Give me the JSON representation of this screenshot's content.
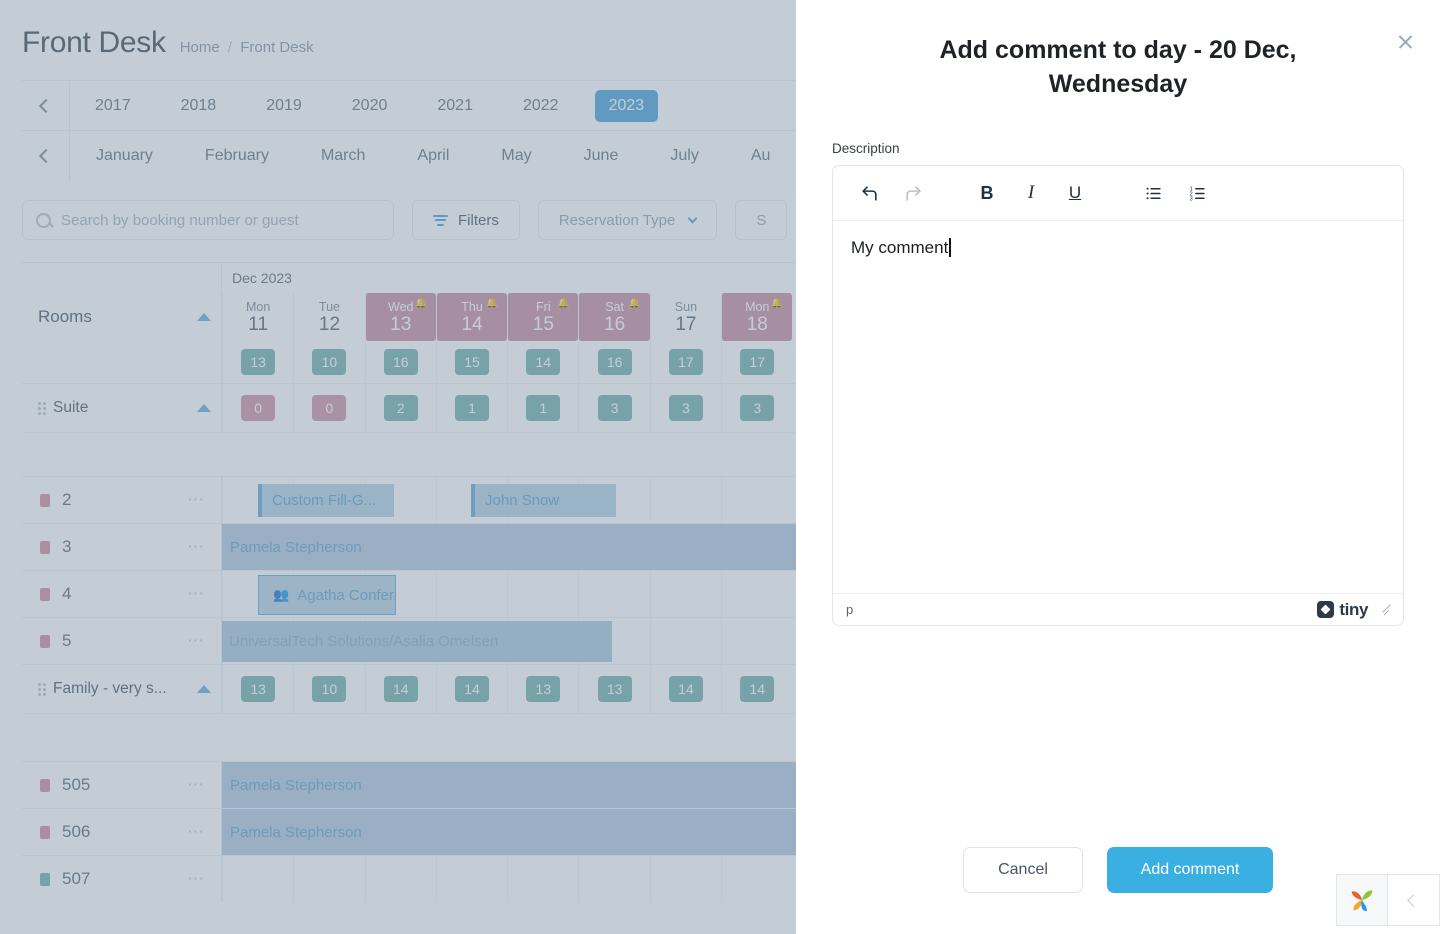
{
  "app": {
    "title": "Front Desk",
    "breadcrumb": {
      "home": "Home",
      "separator": "/",
      "current": "Front Desk"
    },
    "years": [
      "2017",
      "2018",
      "2019",
      "2020",
      "2021",
      "2022",
      "2023"
    ],
    "active_year": "2023",
    "months": [
      "January",
      "February",
      "March",
      "April",
      "May",
      "June",
      "July",
      "Au"
    ],
    "search": {
      "placeholder": "Search by booking number or guest",
      "value": ""
    },
    "filters_label": "Filters",
    "reservation_type_label": "Reservation Type",
    "third_filter_label": "S",
    "accent_color": "#4aa3d8",
    "highlight_day_color": "#c98fa0",
    "count_pill_color": "#74b3ab",
    "count_pill_red_color": "#cf93a2"
  },
  "grid": {
    "month_label": "Dec 2023",
    "rooms_label": "Rooms",
    "days": [
      {
        "dow": "Mon",
        "num": "11",
        "highlight": false,
        "bell": false
      },
      {
        "dow": "Tue",
        "num": "12",
        "highlight": false,
        "bell": false
      },
      {
        "dow": "Wed",
        "num": "13",
        "highlight": true,
        "bell": true
      },
      {
        "dow": "Thu",
        "num": "14",
        "highlight": true,
        "bell": true
      },
      {
        "dow": "Fri",
        "num": "15",
        "highlight": true,
        "bell": true
      },
      {
        "dow": "Sat",
        "num": "16",
        "highlight": true,
        "bell": true
      },
      {
        "dow": "Sun",
        "num": "17",
        "highlight": false,
        "bell": false
      },
      {
        "dow": "Mon",
        "num": "18",
        "highlight": true,
        "bell": true
      }
    ],
    "rooms_counts": [
      "13",
      "10",
      "16",
      "15",
      "14",
      "16",
      "17",
      "17"
    ],
    "groups": [
      {
        "name": "Suite",
        "counts": [
          "0",
          "0",
          "2",
          "1",
          "1",
          "3",
          "3",
          "3"
        ],
        "counts_red": [
          true,
          true,
          false,
          false,
          false,
          false,
          false,
          false
        ],
        "rooms": [
          {
            "num": "2",
            "status": "pink"
          },
          {
            "num": "3",
            "status": "pink"
          },
          {
            "num": "4",
            "status": "pink"
          },
          {
            "num": "5",
            "status": "pink"
          }
        ]
      },
      {
        "name": "Family - very s...",
        "counts": [
          "13",
          "10",
          "14",
          "14",
          "13",
          "13",
          "14",
          "14"
        ],
        "counts_red": [
          false,
          false,
          false,
          false,
          false,
          false,
          false,
          false
        ],
        "rooms": [
          {
            "num": "505",
            "status": "pink"
          },
          {
            "num": "506",
            "status": "pink"
          },
          {
            "num": "507",
            "status": "green"
          }
        ]
      }
    ],
    "reservations": {
      "custom_fill": "Custom Fill-G...",
      "john_snow": "John Snow",
      "pamela_1": "Pamela Stepherson",
      "agatha": "Agatha Confer...",
      "universal": "UniversalTech Solutions/Asalia Omelsen",
      "pamela_505": "Pamela Stepherson",
      "pamela_506": "Pamela Stepherson"
    }
  },
  "modal": {
    "title": "Add comment to day - 20 Dec, Wednesday",
    "description_label": "Description",
    "editor": {
      "content": "My comment",
      "status_path": "p",
      "brand": "tiny",
      "toolbar": [
        {
          "name": "undo",
          "glyph": "↶",
          "disabled": false
        },
        {
          "name": "redo",
          "glyph": "↷",
          "disabled": true
        },
        {
          "name": "bold",
          "glyph": "B",
          "disabled": false
        },
        {
          "name": "italic",
          "glyph": "I",
          "disabled": false
        },
        {
          "name": "underline",
          "glyph": "U",
          "disabled": false
        },
        {
          "name": "bullet-list",
          "glyph": "☰",
          "disabled": false
        },
        {
          "name": "numbered-list",
          "glyph": "☷",
          "disabled": false
        }
      ]
    },
    "cancel_label": "Cancel",
    "submit_label": "Add comment",
    "primary_color": "#3ab0e2"
  }
}
